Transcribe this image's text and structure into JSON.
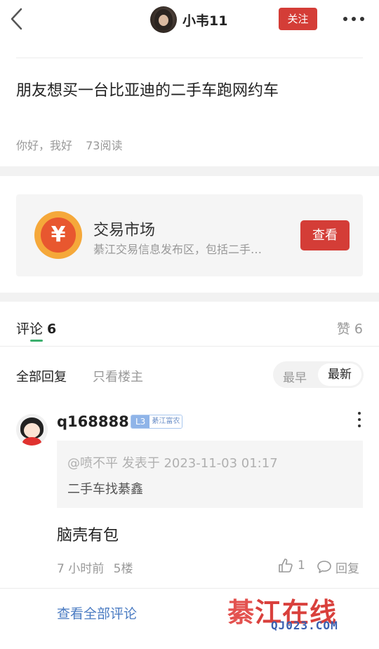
{
  "header": {
    "author_name": "小韦11",
    "follow_label": "关注"
  },
  "post": {
    "title": "朋友想买一台比亚迪的二手车跑网约车",
    "meta_text": "你好，我好",
    "read_count": "73阅读"
  },
  "market": {
    "icon_glyph": "¥",
    "title": "交易市场",
    "description": "綦江交易信息发布区，包括二手…",
    "view_label": "查看"
  },
  "comments_tabs": {
    "comments_label": "评论",
    "comments_count": "6",
    "likes_label": "赞 6"
  },
  "filters": {
    "all_replies": "全部回复",
    "op_only": "只看楼主",
    "sort_earliest": "最早",
    "sort_latest": "最新",
    "active_sort": "最新"
  },
  "comment": {
    "username": "q168888",
    "level": "L3",
    "rank": "綦江富农",
    "quote_meta": "@喷不平 发表于 2023-11-03 01:17",
    "quote_text": "二手车找綦鑫",
    "body": "脑壳有包",
    "time": "7 小时前",
    "floor": "5楼",
    "likes": "1",
    "reply_label": "回复"
  },
  "footer": {
    "view_all_label": "查看全部评论"
  },
  "watermark": {
    "brand_part1": "綦",
    "brand_part2": "江在线",
    "domain": "QJ023.COM"
  },
  "colors": {
    "accent_red": "#d43d37",
    "tab_underline_green": "#3cb06e",
    "link_blue": "#4a7bc2"
  }
}
